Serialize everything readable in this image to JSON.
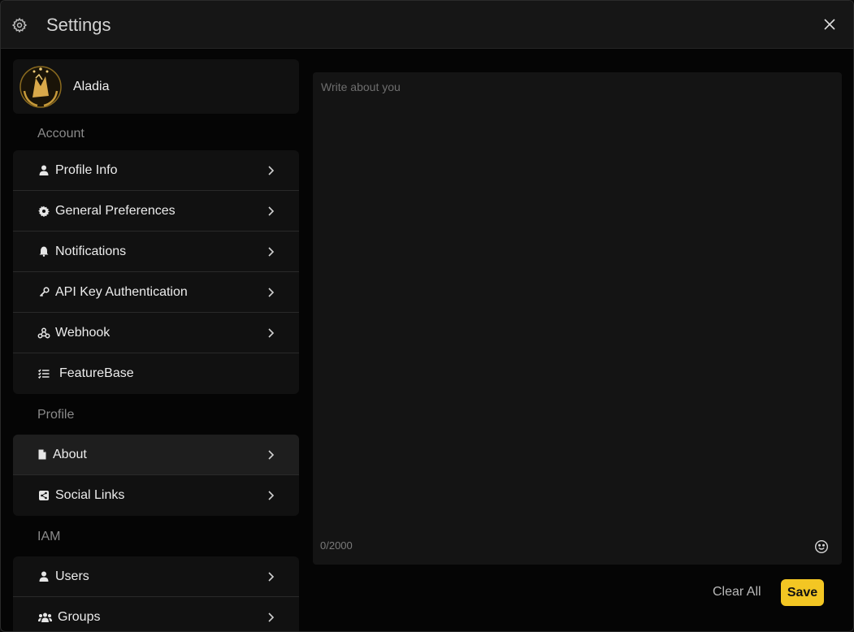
{
  "window": {
    "title": "Settings"
  },
  "profile": {
    "name": "Aladia"
  },
  "sections": {
    "account": {
      "label": "Account",
      "items": [
        {
          "label": "Profile Info",
          "icon": "user-icon",
          "chevron": true
        },
        {
          "label": "General Preferences",
          "icon": "gear-icon",
          "chevron": true
        },
        {
          "label": "Notifications",
          "icon": "bell-icon",
          "chevron": true
        },
        {
          "label": "API Key Authentication",
          "icon": "key-icon",
          "chevron": true
        },
        {
          "label": "Webhook",
          "icon": "webhook-icon",
          "chevron": true
        },
        {
          "label": "FeatureBase",
          "icon": "list-check-icon",
          "chevron": false
        }
      ]
    },
    "profile": {
      "label": "Profile",
      "items": [
        {
          "label": "About",
          "icon": "file-icon",
          "chevron": true,
          "active": true
        },
        {
          "label": "Social Links",
          "icon": "share-icon",
          "chevron": true
        }
      ]
    },
    "iam": {
      "label": "IAM",
      "items": [
        {
          "label": "Users",
          "icon": "user-icon",
          "chevron": true
        },
        {
          "label": "Groups",
          "icon": "users-icon",
          "chevron": true
        }
      ]
    }
  },
  "editor": {
    "placeholder": "Write about you",
    "value": "",
    "char_count": "0/2000"
  },
  "actions": {
    "clear_label": "Clear All",
    "save_label": "Save"
  },
  "colors": {
    "accent": "#f3c623",
    "background": "#050505",
    "panel": "#111111"
  }
}
